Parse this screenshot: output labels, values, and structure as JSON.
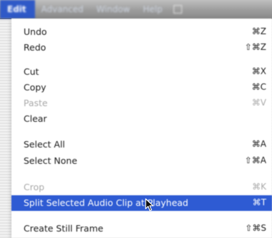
{
  "menubar": {
    "items": [
      {
        "label": "Edit",
        "active": true
      },
      {
        "label": "Advanced"
      },
      {
        "label": "Window"
      },
      {
        "label": "Help"
      }
    ]
  },
  "menu": {
    "items": [
      {
        "label": "Undo",
        "shortcut": "⌘Z",
        "state": "enabled"
      },
      {
        "label": "Redo",
        "shortcut": "⇧⌘Z",
        "state": "enabled"
      },
      {
        "label": "Cut",
        "shortcut": "⌘X",
        "state": "enabled"
      },
      {
        "label": "Copy",
        "shortcut": "⌘C",
        "state": "enabled"
      },
      {
        "label": "Paste",
        "shortcut": "⌘V",
        "state": "disabled"
      },
      {
        "label": "Clear",
        "shortcut": "",
        "state": "enabled"
      },
      {
        "label": "Select All",
        "shortcut": "⌘A",
        "state": "enabled"
      },
      {
        "label": "Select None",
        "shortcut": "⇧⌘A",
        "state": "enabled"
      },
      {
        "label": "Crop",
        "shortcut": "⌘K",
        "state": "disabled"
      },
      {
        "label": "Split Selected Audio Clip at Playhead",
        "shortcut": "⌘T",
        "state": "highlighted"
      },
      {
        "label": "Create Still Frame",
        "shortcut": "⇧⌘S",
        "state": "enabled"
      }
    ]
  },
  "colors": {
    "highlight": "#2e5bd3",
    "active_menu": "#2f59c7",
    "disabled_text": "#a9a9a9"
  }
}
